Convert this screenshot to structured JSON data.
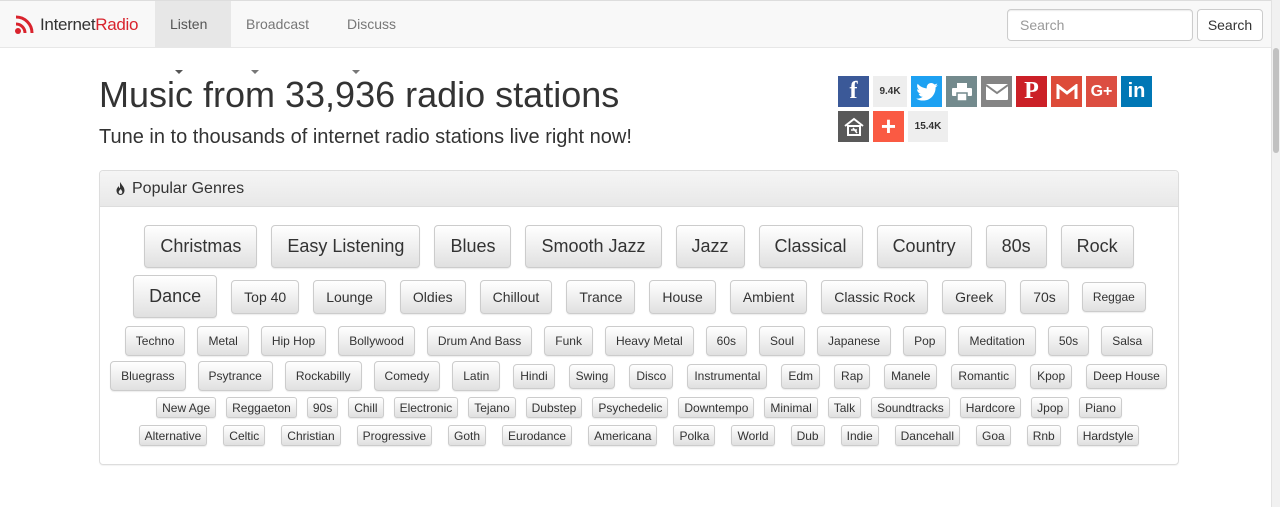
{
  "navbar": {
    "brand_part1": "Internet",
    "brand_part2": "Radio",
    "items": [
      {
        "label": "Listen"
      },
      {
        "label": "Broadcast"
      },
      {
        "label": "Discuss"
      }
    ],
    "search_placeholder": "Search",
    "search_button": "Search"
  },
  "hero": {
    "title": "Music from 33,936 radio stations",
    "subtitle": "Tune in to thousands of internet radio stations live right now!"
  },
  "share": {
    "facebook_count": "9.4K",
    "total_count": "15.4K",
    "icons": [
      "facebook-icon",
      "twitter-icon",
      "print-icon",
      "email-icon",
      "pinterest-icon",
      "gmail-icon",
      "google-plus-icon",
      "linkedin-icon",
      "bookmark-icon",
      "add-more-icon"
    ],
    "colors": {
      "facebook": "#3b5998",
      "twitter": "#1da1f2",
      "print": "#738a8d",
      "email": "#848484",
      "pinterest": "#cb2027",
      "gmail": "#dd4b39",
      "googleplus": "#dc4e41",
      "linkedin": "#0077b5",
      "bookmark": "#595959",
      "more": "#fa5a43"
    }
  },
  "genres": {
    "heading": "Popular Genres",
    "rows": [
      [
        "Christmas",
        "Easy Listening",
        "Blues",
        "Smooth Jazz",
        "Jazz",
        "Classical",
        "Country",
        "80s",
        "Rock"
      ],
      [
        "Dance",
        "Top 40",
        "Lounge",
        "Oldies",
        "Chillout",
        "Trance",
        "House",
        "Ambient",
        "Classic Rock",
        "Greek",
        "70s",
        "Reggae"
      ],
      [
        "Techno",
        "Metal",
        "Hip Hop",
        "Bollywood",
        "Drum And Bass",
        "Funk",
        "Heavy Metal",
        "60s",
        "Soul",
        "Japanese",
        "Pop",
        "Meditation",
        "50s",
        "Salsa"
      ],
      [
        "Bluegrass",
        "Psytrance",
        "Rockabilly",
        "Comedy",
        "Latin",
        "Hindi",
        "Swing",
        "Disco",
        "Instrumental",
        "Edm",
        "Rap",
        "Manele",
        "Romantic",
        "Kpop",
        "Deep House"
      ],
      [
        "New Age",
        "Reggaeton",
        "90s",
        "Chill",
        "Electronic",
        "Tejano",
        "Dubstep",
        "Psychedelic",
        "Downtempo",
        "Minimal",
        "Talk",
        "Soundtracks",
        "Hardcore",
        "Jpop",
        "Piano"
      ],
      [
        "Alternative",
        "Celtic",
        "Christian",
        "Progressive",
        "Goth",
        "Eurodance",
        "Americana",
        "Polka",
        "World",
        "Dub",
        "Indie",
        "Dancehall",
        "Goa",
        "Rnb",
        "Hardstyle"
      ]
    ]
  }
}
